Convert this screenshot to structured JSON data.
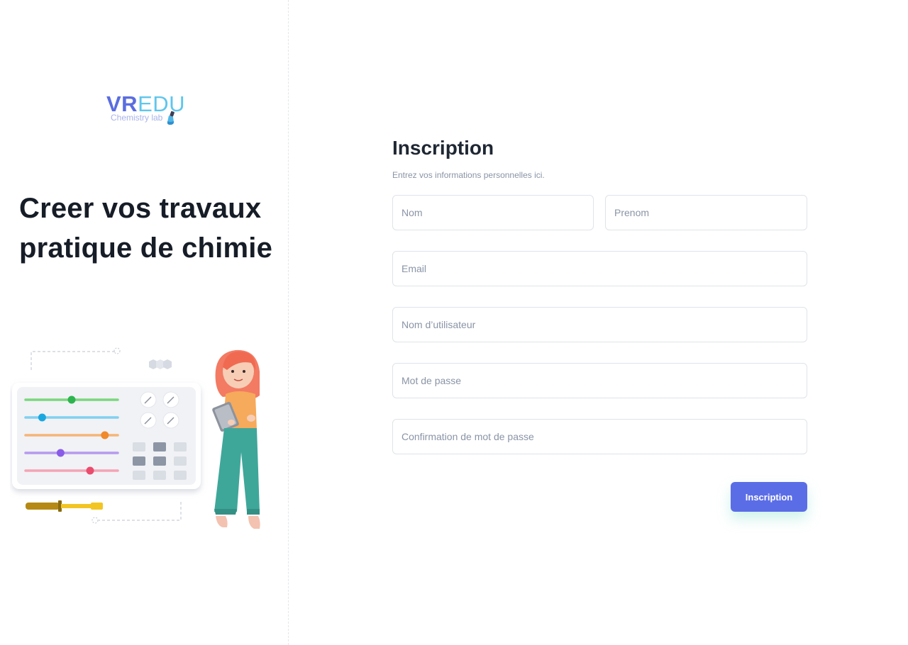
{
  "brand": {
    "vr": "VR",
    "edu": "EDU",
    "subtitle": "Chemistry lab"
  },
  "hero": {
    "headline": "Creer vos travaux pratique de chimie"
  },
  "illustration": {
    "sliders": [
      {
        "color": "#7ad77e",
        "knob": "#2db44f",
        "value": 0.5
      },
      {
        "color": "#7fd0f0",
        "knob": "#1aa7e0",
        "value": 0.18
      },
      {
        "color": "#f5b477",
        "knob": "#f08a2a",
        "value": 0.86
      },
      {
        "color": "#b69af0",
        "knob": "#8a5be8",
        "value": 0.38
      },
      {
        "color": "#f5a3b5",
        "knob": "#ea4c6e",
        "value": 0.7
      }
    ]
  },
  "form": {
    "title": "Inscription",
    "subtitle": "Entrez vos informations personnelles ici.",
    "nom_placeholder": "Nom",
    "prenom_placeholder": "Prenom",
    "email_placeholder": "Email",
    "username_placeholder": "Nom d’utilisateur",
    "password_placeholder": "Mot de passe",
    "confirm_placeholder": "Confirmation de mot de passe",
    "submit_label": "Inscription"
  },
  "colors": {
    "accent": "#5b6de6",
    "brand_vr": "#5a6de0",
    "brand_edu": "#5fc6ec"
  }
}
